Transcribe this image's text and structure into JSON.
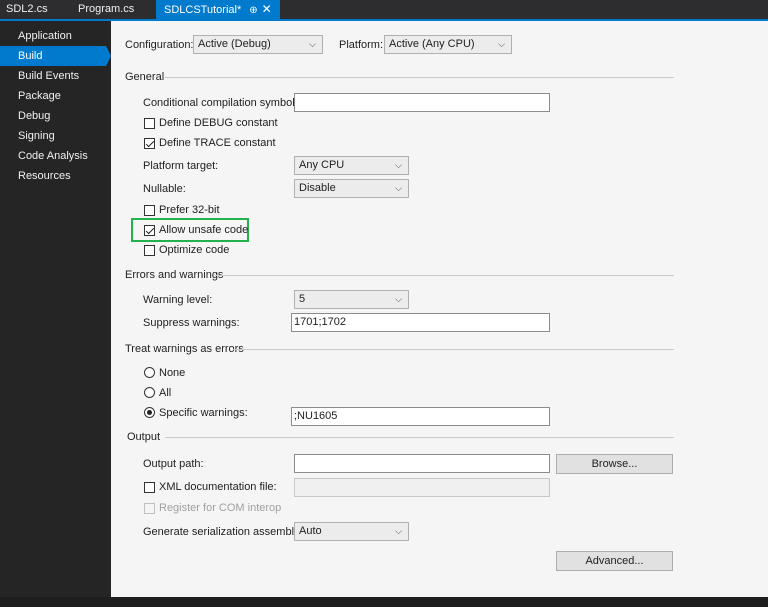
{
  "tabs": [
    {
      "label": "SDL2.cs",
      "active": false
    },
    {
      "label": "Program.cs",
      "active": false
    },
    {
      "label": "SDLCSTutorial*",
      "active": true,
      "pin": "⊕",
      "close": "✕"
    }
  ],
  "sidebar": {
    "items": [
      {
        "label": "Application"
      },
      {
        "label": "Build",
        "selected": true
      },
      {
        "label": "Build Events"
      },
      {
        "label": "Package"
      },
      {
        "label": "Debug"
      },
      {
        "label": "Signing"
      },
      {
        "label": "Code Analysis"
      },
      {
        "label": "Resources"
      }
    ]
  },
  "header": {
    "configuration_label": "Configuration:",
    "configuration_value": "Active (Debug)",
    "platform_label": "Platform:",
    "platform_value": "Active (Any CPU)"
  },
  "general": {
    "title": "General",
    "conditional_label": "Conditional compilation symbols:",
    "conditional_value": "",
    "define_debug": {
      "label": "Define DEBUG constant",
      "checked": false
    },
    "define_trace": {
      "label": "Define TRACE constant",
      "checked": true
    },
    "platform_target_label": "Platform target:",
    "platform_target_value": "Any CPU",
    "nullable_label": "Nullable:",
    "nullable_value": "Disable",
    "prefer32": {
      "label": "Prefer 32-bit",
      "checked": false
    },
    "allow_unsafe": {
      "label": "Allow unsafe code",
      "checked": true
    },
    "optimize": {
      "label": "Optimize code",
      "checked": false
    }
  },
  "errors": {
    "title": "Errors and warnings",
    "warning_level_label": "Warning level:",
    "warning_level_value": "5",
    "suppress_label": "Suppress warnings:",
    "suppress_value": "1701;1702"
  },
  "treat": {
    "title": "Treat warnings as errors",
    "none_label": "None",
    "all_label": "All",
    "specific_label": "Specific warnings:",
    "specific_value": ";NU1605",
    "selected": "specific"
  },
  "output": {
    "title": "Output",
    "output_path_label": "Output path:",
    "output_path_value": "",
    "browse_label": "Browse...",
    "xml_doc": {
      "label": "XML documentation file:",
      "checked": false
    },
    "xml_doc_value": "",
    "register_com": {
      "label": "Register for COM interop",
      "checked": false,
      "disabled": true
    },
    "serialization_label": "Generate serialization assembly:",
    "serialization_value": "Auto",
    "advanced_label": "Advanced..."
  },
  "colors": {
    "accent": "#007acc",
    "highlight": "#22b14c",
    "sidebar_bg": "#252526",
    "page_bg": "#f5f5f5"
  },
  "icons": {
    "dropdown": "chevron-down-icon",
    "checkbox_checked": "checkmark-icon"
  }
}
